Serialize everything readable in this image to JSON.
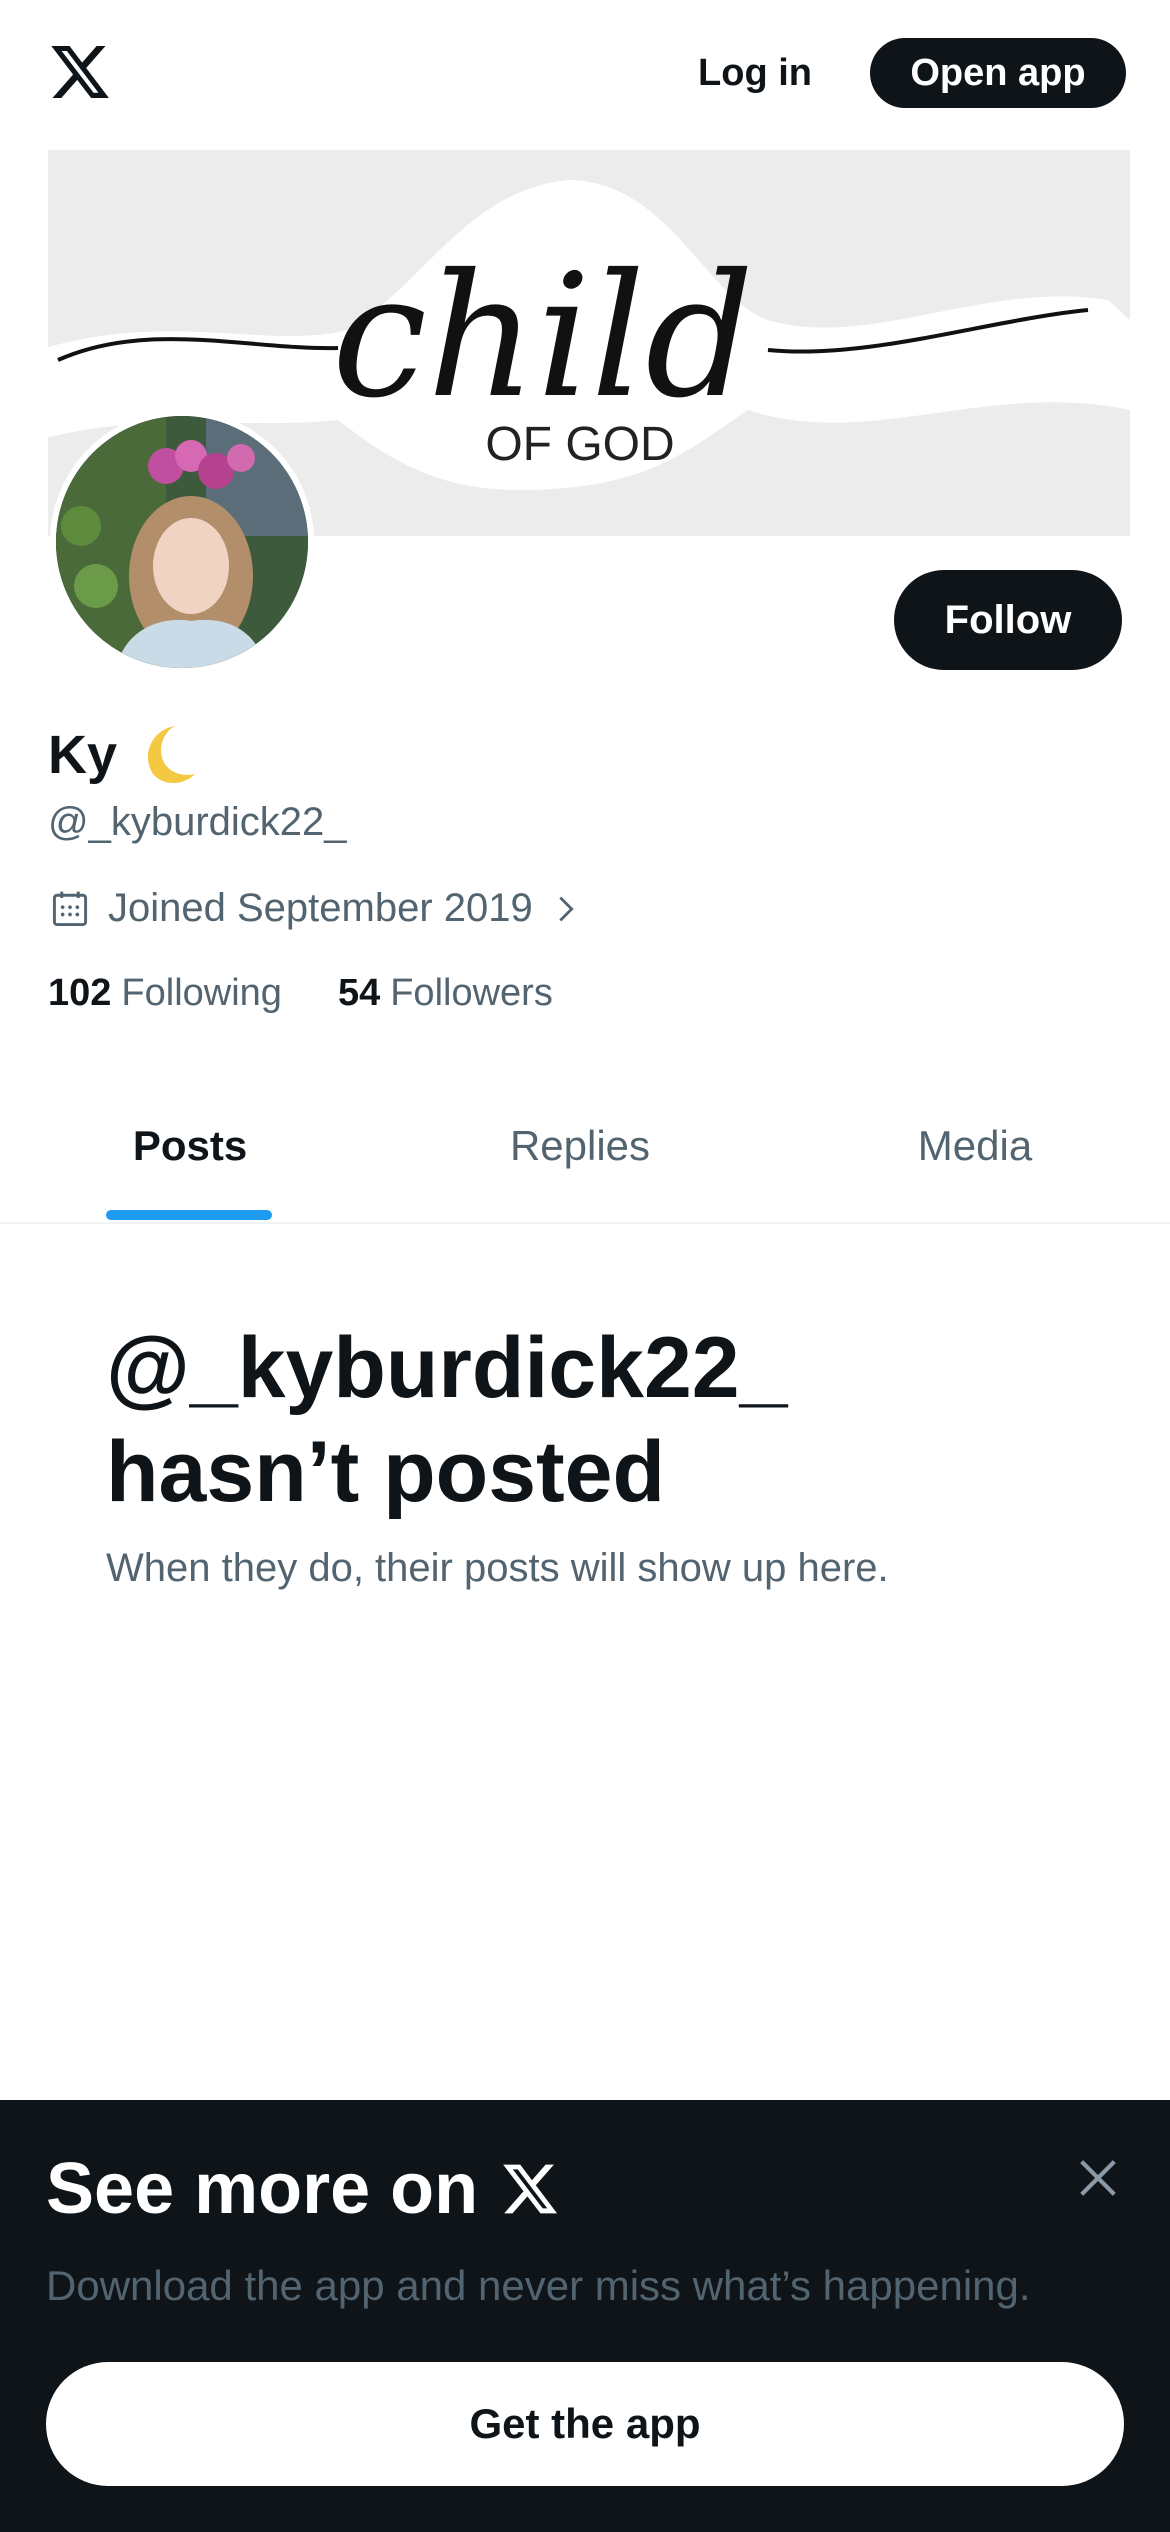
{
  "header": {
    "login_label": "Log in",
    "open_app_label": "Open app"
  },
  "banner": {
    "script_text": "child",
    "sub_text": "OF GOD"
  },
  "profile": {
    "display_name": "Ky",
    "name_emoji_icon": "crescent-moon-icon",
    "handle": "@_kyburdick22_",
    "joined": "Joined September 2019",
    "following_count": "102",
    "following_label": "Following",
    "followers_count": "54",
    "followers_label": "Followers",
    "follow_label": "Follow"
  },
  "tabs": [
    {
      "label": "Posts",
      "active": true
    },
    {
      "label": "Replies",
      "active": false
    },
    {
      "label": "Media",
      "active": false
    }
  ],
  "empty_state": {
    "title_line1": "@_kyburdick22_",
    "title_line2": "hasn’t posted",
    "subtitle": "When they do, their posts will show up here."
  },
  "bottom_sheet": {
    "title": "See more on",
    "subtitle": "Download the app and never miss what’s happening.",
    "button_label": "Get the app"
  },
  "colors": {
    "accent": "#1d9bf0",
    "primary_text": "#0f1419",
    "secondary_text": "#536471",
    "sheet_bg": "#0f1419"
  }
}
